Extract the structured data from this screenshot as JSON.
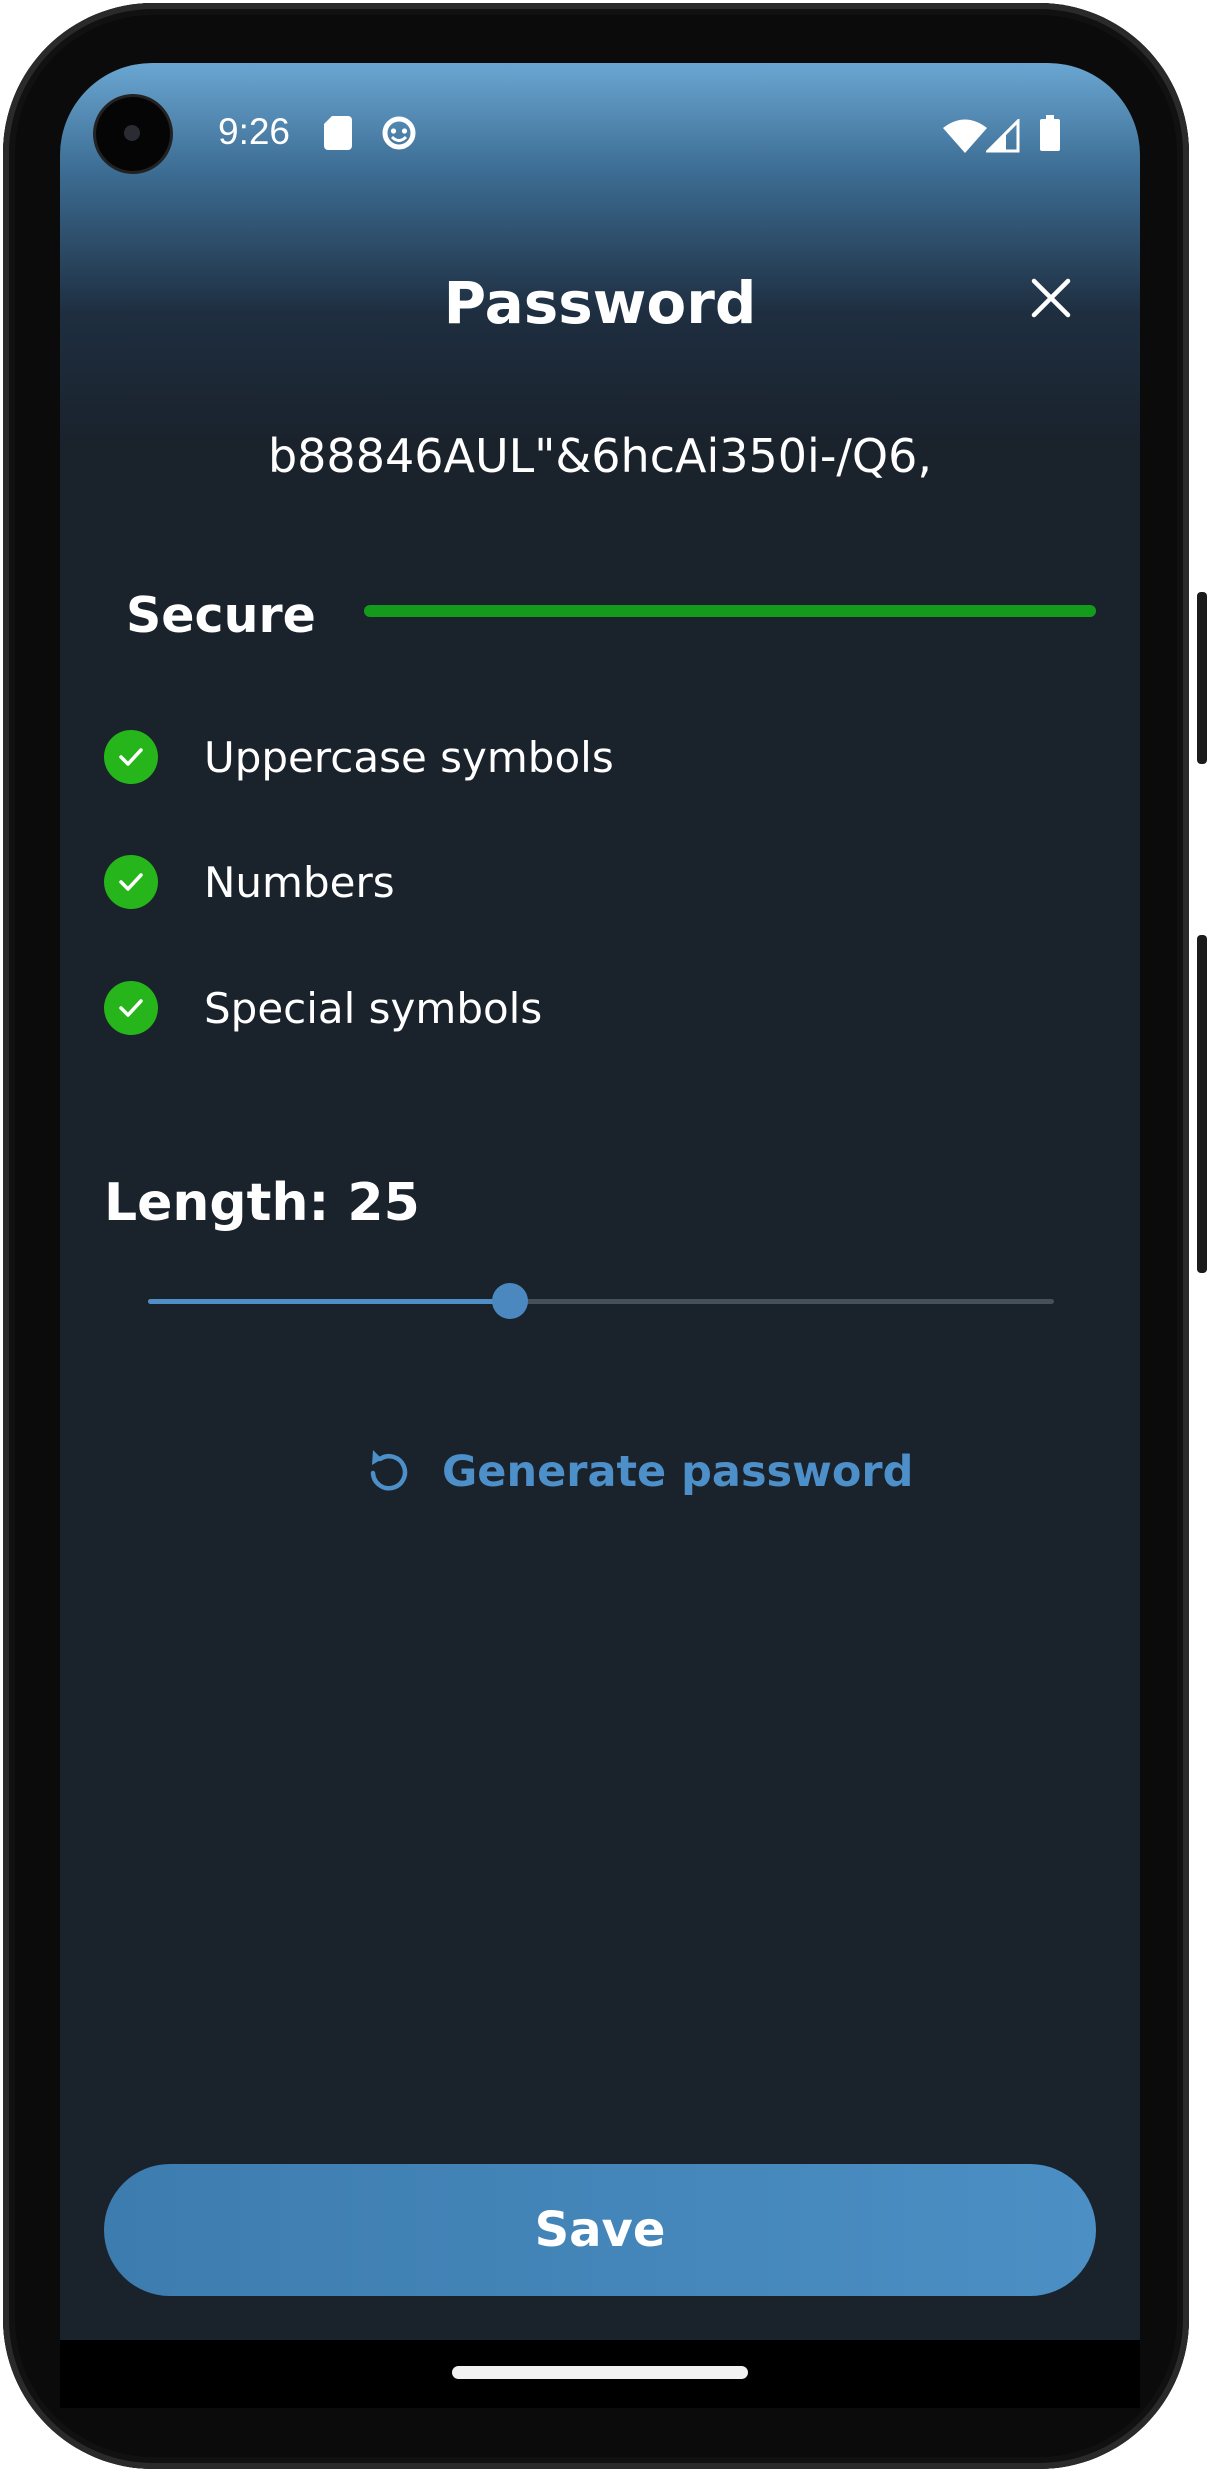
{
  "status_bar": {
    "time": "9:26",
    "icons": [
      "sd-card-icon",
      "face-icon",
      "wifi-icon",
      "signal-icon",
      "battery-icon"
    ]
  },
  "dialog": {
    "title": "Password",
    "close_icon": "close-icon",
    "password": "b88846AUL\"&6hcAi350i-/Q6,",
    "strength": {
      "label": "Secure",
      "level": 1.0,
      "color": "#149b1c"
    },
    "criteria": [
      {
        "label": "Uppercase symbols",
        "checked": true
      },
      {
        "label": "Numbers",
        "checked": true
      },
      {
        "label": "Special symbols",
        "checked": true
      }
    ],
    "length": {
      "label": "Length: 25",
      "slider_fraction": 0.4
    },
    "generate": {
      "icon": "refresh-icon",
      "label": "Generate password"
    },
    "save_label": "Save"
  },
  "colors": {
    "accent": "#4d8fc8",
    "background": "#1a222c",
    "check_green": "#26b51a"
  }
}
